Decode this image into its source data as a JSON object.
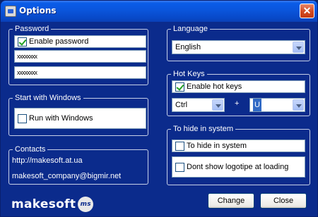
{
  "window": {
    "title": "Options",
    "icon": "app-icon",
    "close_icon": "close-icon"
  },
  "password": {
    "legend": "Password",
    "enable_label": "Enable password",
    "enable_checked": true,
    "field1": "xxxxxxxx",
    "field2": "xxxxxxxx"
  },
  "startup": {
    "legend": "Start with Windows",
    "run_label": "Run with Windows",
    "run_checked": false
  },
  "contacts": {
    "legend": "Contacts",
    "url": "http://makesoft.at.ua",
    "email": "makesoft_company@bigmir.net"
  },
  "language": {
    "legend": "Language",
    "selected": "English"
  },
  "hotkeys": {
    "legend": "Hot Keys",
    "enable_label": "Enable hot keys",
    "enable_checked": true,
    "modifier": "Ctrl",
    "plus": "+",
    "key": "U"
  },
  "hide": {
    "legend": "To hide in system",
    "hide_label": "To hide in system",
    "hide_checked": false,
    "logo_label": "Dont show logotipe at loading",
    "logo_checked": false
  },
  "logo": {
    "text": "makesoft",
    "badge": "ms"
  },
  "buttons": {
    "change": "Change",
    "close": "Close"
  }
}
